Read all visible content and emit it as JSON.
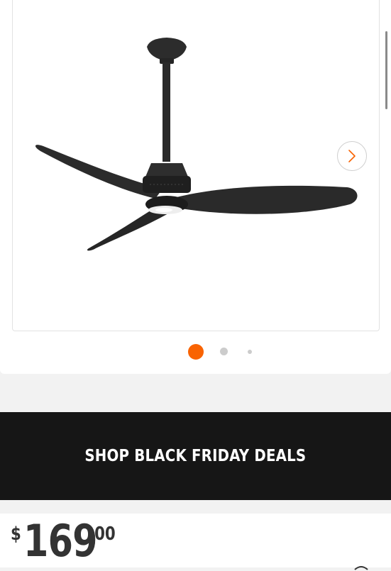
{
  "gallery": {
    "product_image": "ceiling-fan-image",
    "next_icon": "chevron-right-icon",
    "active_slide": 1,
    "slide_count": 3
  },
  "promo": {
    "label": "SHOP BLACK FRIDAY DEALS"
  },
  "pricing": {
    "currency": "$",
    "dollars": "169",
    "cents": "00"
  },
  "colors": {
    "accent": "#f96302",
    "banner_bg": "#161616",
    "banner_text": "#ffffff",
    "price_text": "#333333",
    "dot_inactive": "#cccccc"
  }
}
